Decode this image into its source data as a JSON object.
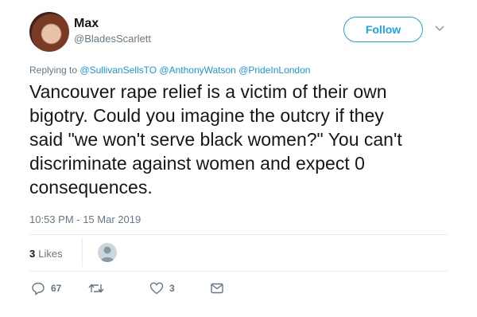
{
  "author": {
    "name": "Max",
    "handle": "@BladesScarlett"
  },
  "follow_label": "Follow",
  "replying": {
    "prefix": "Replying to",
    "mentions": [
      "@SullivanSellsTO",
      "@AnthonyWatson",
      "@PrideInLondon"
    ]
  },
  "tweet_text": "Vancouver rape relief is a victim of their own\nbigotry. Could you imagine the outcry if they\nsaid \"we won't serve black women?\" You can't\ndiscriminate against women and expect 0\nconsequences.",
  "timestamp": "10:53 PM - 15 Mar 2019",
  "likes": {
    "count": "3",
    "label": "Likes"
  },
  "actions": {
    "reply_count": "67",
    "retweet_count": "",
    "like_count": "3"
  },
  "colors": {
    "accent": "#1da1f2",
    "mention": "#1b95e0",
    "muted": "#657786",
    "divider": "#e6ecf0"
  },
  "icons": [
    "chevron-down-icon",
    "reply-icon",
    "retweet-icon",
    "heart-icon",
    "direct-message-icon"
  ]
}
